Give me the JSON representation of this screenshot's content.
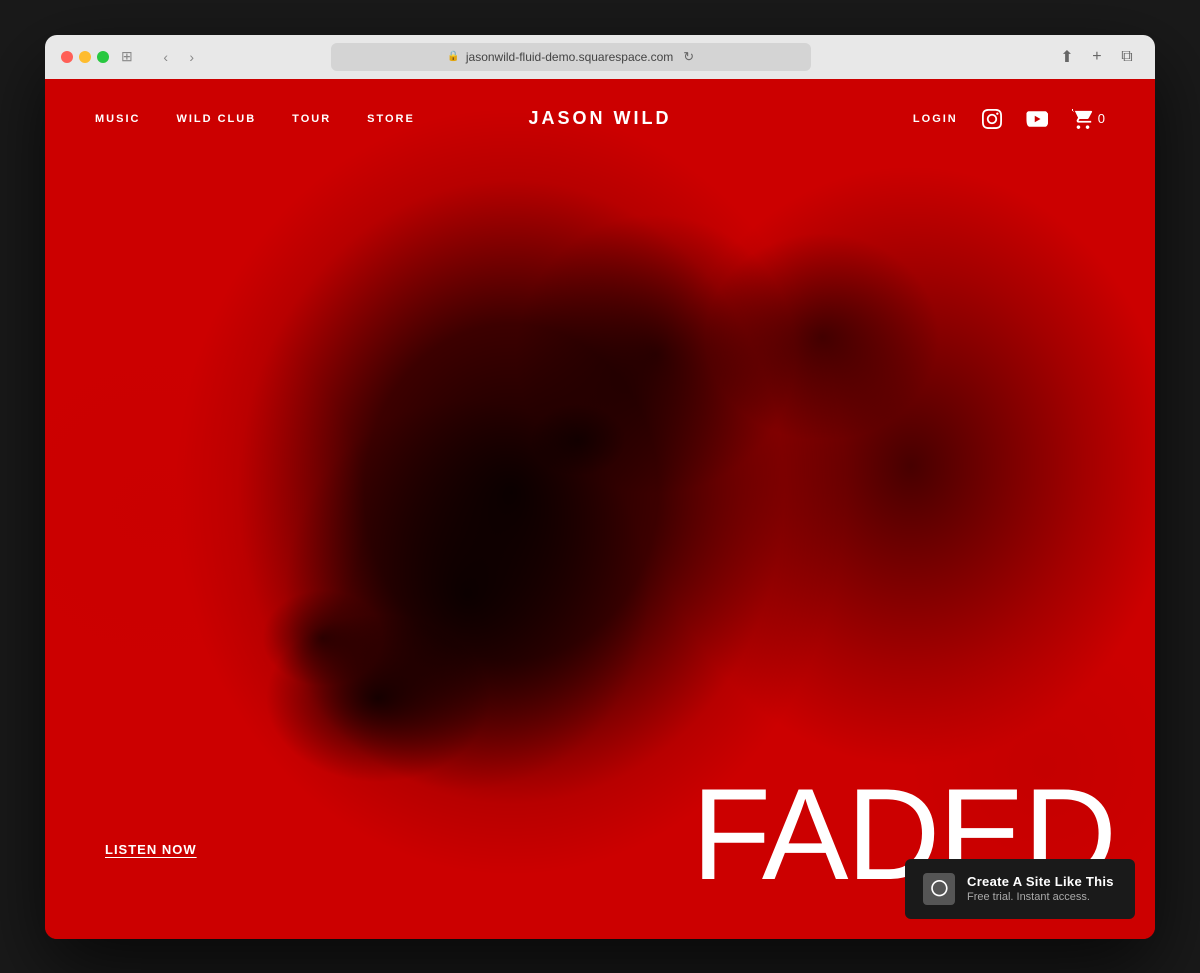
{
  "browser": {
    "url": "jasonwild-fluid-demo.squarespace.com",
    "back_btn": "‹",
    "forward_btn": "›",
    "refresh_icon": "↻",
    "share_icon": "⬆",
    "new_tab_icon": "+",
    "sidebar_icon": "⊞"
  },
  "nav": {
    "music": "MUSIC",
    "wild_club": "WILD CLUB",
    "tour": "TOUR",
    "store": "STORE",
    "site_title": "JASON WILD",
    "login": "LOGIN",
    "cart_count": "0"
  },
  "hero": {
    "listen_now": "LISTEN NOW",
    "faded_title": "FADED"
  },
  "squarespace": {
    "title": "Create A Site Like This",
    "subtitle": "Free trial. Instant access."
  }
}
